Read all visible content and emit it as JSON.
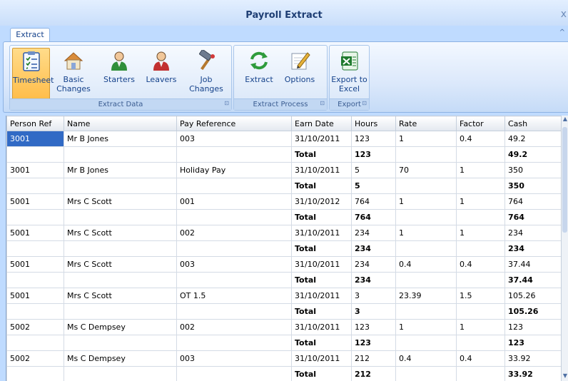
{
  "window": {
    "title": "Payroll Extract",
    "close": "x",
    "collapse": "^"
  },
  "tabs": [
    {
      "label": "Extract"
    }
  ],
  "ribbon": {
    "groups": [
      {
        "label": "Extract Data",
        "launcher": "⊡",
        "buttons": [
          {
            "label": "Timesheet",
            "icon": "timesheet-icon"
          },
          {
            "label": "Basic Changes",
            "icon": "house-icon"
          },
          {
            "label": "Starters",
            "icon": "person-green-icon"
          },
          {
            "label": "Leavers",
            "icon": "person-red-icon"
          },
          {
            "label": "Job Changes",
            "icon": "hammer-icon"
          }
        ]
      },
      {
        "label": "Extract Process",
        "launcher": "⊡",
        "buttons": [
          {
            "label": "Extract",
            "icon": "refresh-arrows-icon"
          },
          {
            "label": "Options",
            "icon": "pencil-icon"
          }
        ]
      },
      {
        "label": "Export",
        "launcher": "⊡",
        "buttons": [
          {
            "label": "Export to Excel",
            "icon": "excel-icon"
          }
        ]
      }
    ]
  },
  "grid": {
    "columns": [
      "Person Ref",
      "Name",
      "Pay Reference",
      "Earn Date",
      "Hours",
      "Rate",
      "Factor",
      "Cash"
    ],
    "rows": [
      {
        "type": "data",
        "cells": [
          "3001",
          "Mr B Jones",
          "003",
          "31/10/2011",
          "123",
          "1",
          "0.4",
          "49.2"
        ]
      },
      {
        "type": "total",
        "cells": [
          "",
          "",
          "",
          "Total",
          "123",
          "",
          "",
          "49.2"
        ]
      },
      {
        "type": "data",
        "cells": [
          "3001",
          "Mr B Jones",
          "Holiday Pay",
          "31/10/2011",
          "5",
          "70",
          "1",
          "350"
        ]
      },
      {
        "type": "total",
        "cells": [
          "",
          "",
          "",
          "Total",
          "5",
          "",
          "",
          "350"
        ]
      },
      {
        "type": "data",
        "cells": [
          "5001",
          "Mrs C Scott",
          "001",
          "31/10/2012",
          "764",
          "1",
          "1",
          "764"
        ]
      },
      {
        "type": "total",
        "cells": [
          "",
          "",
          "",
          "Total",
          "764",
          "",
          "",
          "764"
        ]
      },
      {
        "type": "data",
        "cells": [
          "5001",
          "Mrs C Scott",
          "002",
          "31/10/2011",
          "234",
          "1",
          "1",
          "234"
        ]
      },
      {
        "type": "total",
        "cells": [
          "",
          "",
          "",
          "Total",
          "234",
          "",
          "",
          "234"
        ]
      },
      {
        "type": "data",
        "cells": [
          "5001",
          "Mrs C Scott",
          "003",
          "31/10/2011",
          "234",
          "0.4",
          "0.4",
          "37.44"
        ]
      },
      {
        "type": "total",
        "cells": [
          "",
          "",
          "",
          "Total",
          "234",
          "",
          "",
          "37.44"
        ]
      },
      {
        "type": "data",
        "cells": [
          "5001",
          "Mrs C Scott",
          "OT 1.5",
          "31/10/2011",
          "3",
          "23.39",
          "1.5",
          "105.26"
        ]
      },
      {
        "type": "total",
        "cells": [
          "",
          "",
          "",
          "Total",
          "3",
          "",
          "",
          "105.26"
        ]
      },
      {
        "type": "data",
        "cells": [
          "5002",
          "Ms C Dempsey",
          "002",
          "31/10/2011",
          "123",
          "1",
          "1",
          "123"
        ]
      },
      {
        "type": "total",
        "cells": [
          "",
          "",
          "",
          "Total",
          "123",
          "",
          "",
          "123"
        ]
      },
      {
        "type": "data",
        "cells": [
          "5002",
          "Ms C Dempsey",
          "003",
          "31/10/2011",
          "212",
          "0.4",
          "0.4",
          "33.92"
        ]
      },
      {
        "type": "total",
        "cells": [
          "",
          "",
          "",
          "Total",
          "212",
          "",
          "",
          "33.92"
        ]
      }
    ]
  },
  "colors": {
    "ribbon_bg": "#bfdbff",
    "active_button": "#ffbd4a",
    "selected_cell": "#316ac5"
  }
}
